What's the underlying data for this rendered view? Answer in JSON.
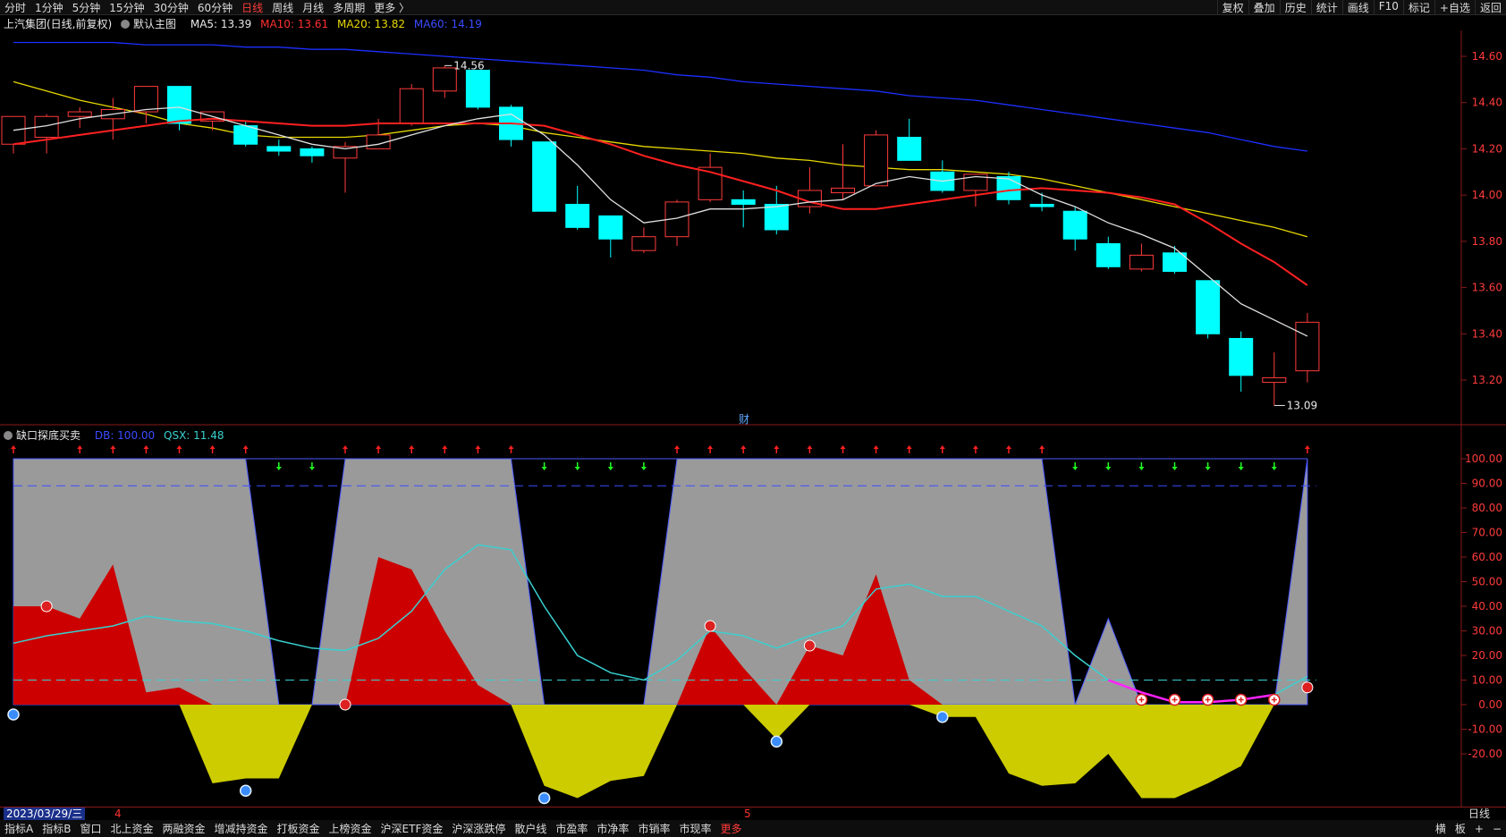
{
  "toolbar": {
    "periods": [
      "分时",
      "1分钟",
      "5分钟",
      "15分钟",
      "30分钟",
      "60分钟",
      "日线",
      "周线",
      "月线",
      "多周期",
      "更多 〉"
    ],
    "active_period": "日线",
    "right_buttons": [
      "复权",
      "叠加",
      "历史",
      "统计",
      "画线",
      "F10",
      "标记",
      "+自选",
      "返回"
    ]
  },
  "main_panel": {
    "title": "上汽集团(日线,前复权)",
    "template": "默认主图",
    "ma5": "MA5: 13.39",
    "ma10": "MA10: 13.61",
    "ma20": "MA20: 13.82",
    "ma60": "MA60: 14.19",
    "high_label": "14.56",
    "low_label": "13.09",
    "fin_marker": "财",
    "y_ticks": [
      "14.60",
      "14.40",
      "14.20",
      "14.00",
      "13.80",
      "13.60",
      "13.40",
      "13.20"
    ],
    "colors": {
      "ma5": "#e0e0e0",
      "ma10": "#ff2020",
      "ma20": "#e8d800",
      "ma60": "#1c2fff",
      "up": "#ff3b3b",
      "down": "#00ffff"
    }
  },
  "indicator_panel": {
    "name": "缺口探底买卖",
    "db": "DB: 100.00",
    "qsx": "QSX: 11.48",
    "y_ticks": [
      "100.00",
      "90.00",
      "80.00",
      "70.00",
      "60.00",
      "50.00",
      "40.00",
      "30.00",
      "20.00",
      "10.00",
      "0.00",
      "-10.00",
      "-20.00"
    ]
  },
  "date_bar": {
    "date": "2023/03/29/三",
    "month_marks": [
      "4",
      "5"
    ],
    "period_tag": "日线"
  },
  "bottom_tabs": [
    "指标A",
    "指标B",
    "窗口",
    "北上资金",
    "两融资金",
    "增减持资金",
    "打板资金",
    "上榜资金",
    "沪深ETF资金",
    "沪深涨跌停",
    "散户线",
    "市盈率",
    "市净率",
    "市销率",
    "市现率",
    "更多"
  ],
  "bottom_right": [
    "横",
    "板",
    "+",
    "−"
  ],
  "chart_data": [
    {
      "type": "candlestick",
      "title": "上汽集团(日线,前复权)",
      "ylim": [
        13.0,
        14.7
      ],
      "candles": [
        {
          "o": 14.22,
          "h": 14.28,
          "l": 14.18,
          "c": 14.34
        },
        {
          "o": 14.25,
          "h": 14.35,
          "l": 14.18,
          "c": 14.34
        },
        {
          "o": 14.34,
          "h": 14.38,
          "l": 14.29,
          "c": 14.36
        },
        {
          "o": 14.33,
          "h": 14.42,
          "l": 14.24,
          "c": 14.37
        },
        {
          "o": 14.36,
          "h": 14.47,
          "l": 14.31,
          "c": 14.47
        },
        {
          "o": 14.47,
          "h": 14.47,
          "l": 14.28,
          "c": 14.31
        },
        {
          "o": 14.32,
          "h": 14.36,
          "l": 14.28,
          "c": 14.36
        },
        {
          "o": 14.3,
          "h": 14.32,
          "l": 14.21,
          "c": 14.22
        },
        {
          "o": 14.21,
          "h": 14.24,
          "l": 14.17,
          "c": 14.19
        },
        {
          "o": 14.2,
          "h": 14.21,
          "l": 14.14,
          "c": 14.17
        },
        {
          "o": 14.16,
          "h": 14.23,
          "l": 14.01,
          "c": 14.21
        },
        {
          "o": 14.2,
          "h": 14.33,
          "l": 14.2,
          "c": 14.26
        },
        {
          "o": 14.31,
          "h": 14.48,
          "l": 14.3,
          "c": 14.46
        },
        {
          "o": 14.45,
          "h": 14.56,
          "l": 14.42,
          "c": 14.55
        },
        {
          "o": 14.54,
          "h": 14.54,
          "l": 14.37,
          "c": 14.38
        },
        {
          "o": 14.38,
          "h": 14.39,
          "l": 14.21,
          "c": 14.24
        },
        {
          "o": 14.23,
          "h": 14.23,
          "l": 13.93,
          "c": 13.93
        },
        {
          "o": 13.96,
          "h": 14.04,
          "l": 13.85,
          "c": 13.86
        },
        {
          "o": 13.91,
          "h": 13.91,
          "l": 13.73,
          "c": 13.81
        },
        {
          "o": 13.76,
          "h": 13.86,
          "l": 13.75,
          "c": 13.82
        },
        {
          "o": 13.82,
          "h": 13.98,
          "l": 13.78,
          "c": 13.97
        },
        {
          "o": 13.98,
          "h": 14.18,
          "l": 13.97,
          "c": 14.12
        },
        {
          "o": 13.98,
          "h": 14.02,
          "l": 13.86,
          "c": 13.96
        },
        {
          "o": 13.96,
          "h": 14.04,
          "l": 13.83,
          "c": 13.85
        },
        {
          "o": 13.95,
          "h": 14.12,
          "l": 13.92,
          "c": 14.02
        },
        {
          "o": 14.01,
          "h": 14.22,
          "l": 13.98,
          "c": 14.03
        },
        {
          "o": 14.04,
          "h": 14.28,
          "l": 14.04,
          "c": 14.26
        },
        {
          "o": 14.25,
          "h": 14.33,
          "l": 14.15,
          "c": 14.15
        },
        {
          "o": 14.1,
          "h": 14.15,
          "l": 14.01,
          "c": 14.02
        },
        {
          "o": 14.02,
          "h": 14.09,
          "l": 13.95,
          "c": 14.09
        },
        {
          "o": 14.08,
          "h": 14.1,
          "l": 13.96,
          "c": 13.98
        },
        {
          "o": 13.96,
          "h": 14.01,
          "l": 13.93,
          "c": 13.95
        },
        {
          "o": 13.93,
          "h": 13.95,
          "l": 13.76,
          "c": 13.81
        },
        {
          "o": 13.79,
          "h": 13.82,
          "l": 13.68,
          "c": 13.69
        },
        {
          "o": 13.68,
          "h": 13.79,
          "l": 13.67,
          "c": 13.74
        },
        {
          "o": 13.75,
          "h": 13.78,
          "l": 13.66,
          "c": 13.67
        },
        {
          "o": 13.63,
          "h": 13.63,
          "l": 13.38,
          "c": 13.4
        },
        {
          "o": 13.38,
          "h": 13.41,
          "l": 13.15,
          "c": 13.22
        },
        {
          "o": 13.19,
          "h": 13.32,
          "l": 13.09,
          "c": 13.21
        },
        {
          "o": 13.24,
          "h": 13.49,
          "l": 13.19,
          "c": 13.45
        }
      ],
      "ma5": [
        14.28,
        14.3,
        14.33,
        14.35,
        14.37,
        14.38,
        14.34,
        14.3,
        14.26,
        14.22,
        14.2,
        14.22,
        14.26,
        14.3,
        14.33,
        14.35,
        14.26,
        14.13,
        13.98,
        13.88,
        13.9,
        13.94,
        13.94,
        13.95,
        13.97,
        13.98,
        14.05,
        14.08,
        14.06,
        14.08,
        14.07,
        14.0,
        13.95,
        13.88,
        13.83,
        13.77,
        13.65,
        13.53,
        13.46,
        13.39
      ],
      "ma10": [
        14.22,
        14.24,
        14.26,
        14.28,
        14.3,
        14.32,
        14.33,
        14.32,
        14.31,
        14.3,
        14.3,
        14.31,
        14.31,
        14.31,
        14.31,
        14.31,
        14.3,
        14.26,
        14.22,
        14.17,
        14.13,
        14.1,
        14.06,
        14.02,
        13.97,
        13.94,
        13.94,
        13.96,
        13.98,
        14.0,
        14.02,
        14.03,
        14.02,
        14.01,
        13.99,
        13.96,
        13.88,
        13.79,
        13.71,
        13.61
      ],
      "ma20": [
        14.49,
        14.45,
        14.41,
        14.38,
        14.35,
        14.31,
        14.29,
        14.26,
        14.25,
        14.25,
        14.25,
        14.26,
        14.28,
        14.3,
        14.31,
        14.3,
        14.27,
        14.25,
        14.23,
        14.21,
        14.2,
        14.19,
        14.18,
        14.16,
        14.15,
        14.13,
        14.12,
        14.11,
        14.11,
        14.1,
        14.09,
        14.07,
        14.04,
        14.01,
        13.98,
        13.95,
        13.92,
        13.89,
        13.86,
        13.82
      ],
      "ma60": [
        14.66,
        14.66,
        14.66,
        14.66,
        14.65,
        14.65,
        14.65,
        14.64,
        14.64,
        14.63,
        14.63,
        14.62,
        14.61,
        14.6,
        14.59,
        14.58,
        14.57,
        14.56,
        14.55,
        14.54,
        14.52,
        14.51,
        14.49,
        14.48,
        14.47,
        14.46,
        14.45,
        14.43,
        14.42,
        14.41,
        14.39,
        14.37,
        14.35,
        14.33,
        14.31,
        14.29,
        14.27,
        14.24,
        14.21,
        14.19
      ]
    },
    {
      "type": "area",
      "title": "缺口探底买卖",
      "ylim": [
        -30,
        105
      ],
      "grey": [
        100,
        100,
        100,
        100,
        100,
        100,
        100,
        100,
        0,
        0,
        100,
        100,
        100,
        100,
        100,
        100,
        0,
        0,
        0,
        0,
        100,
        100,
        100,
        100,
        100,
        100,
        100,
        100,
        100,
        100,
        100,
        100,
        0,
        35,
        0,
        0,
        0,
        0,
        0,
        100
      ],
      "red": [
        40,
        40,
        35,
        57,
        5,
        7,
        0,
        0,
        0,
        0,
        0,
        60,
        55,
        30,
        8,
        0,
        0,
        0,
        0,
        0,
        0,
        32,
        15,
        0,
        24,
        20,
        53,
        10,
        0,
        0,
        0,
        0,
        0,
        0,
        0,
        0,
        0,
        0,
        0,
        0
      ],
      "yellow": [
        0,
        0,
        0,
        0,
        0,
        0,
        -32,
        -30,
        -30,
        0,
        0,
        0,
        0,
        0,
        0,
        0,
        -33,
        -38,
        -31,
        -29,
        0,
        0,
        0,
        -14,
        0,
        0,
        0,
        0,
        -5,
        -5,
        -28,
        -33,
        -32,
        -20,
        -38,
        -38,
        -32,
        -25,
        0,
        0
      ],
      "qsx": [
        25,
        28,
        30,
        32,
        36,
        34,
        33,
        30,
        26,
        23,
        22,
        27,
        38,
        55,
        65,
        63,
        40,
        20,
        13,
        10,
        18,
        30,
        28,
        23,
        28,
        32,
        47,
        49,
        44,
        44,
        38,
        32,
        20,
        10,
        5,
        1,
        1,
        2,
        4,
        11.48
      ],
      "db": 100,
      "dashed_blue": 89,
      "dashed_cyan": 10,
      "up_arrows": [
        0,
        2,
        3,
        4,
        5,
        6,
        7,
        10,
        11,
        12,
        13,
        14,
        15,
        20,
        21,
        22,
        23,
        24,
        25,
        26,
        27,
        28,
        29,
        30,
        31,
        39
      ],
      "down_arrows": [
        8,
        9,
        16,
        17,
        18,
        19,
        32,
        33,
        34,
        35,
        36,
        37,
        38
      ],
      "red_balls": [
        [
          1,
          40
        ],
        [
          10,
          0
        ],
        [
          21,
          32
        ],
        [
          24,
          24
        ],
        [
          39,
          7
        ]
      ],
      "blue_balls": [
        [
          0,
          -4
        ],
        [
          7,
          -35
        ],
        [
          16,
          -38
        ],
        [
          23,
          -15
        ],
        [
          28,
          -5
        ]
      ],
      "plus_markers": [
        [
          34,
          2
        ],
        [
          35,
          2
        ],
        [
          36,
          2
        ],
        [
          37,
          2
        ],
        [
          38,
          2
        ]
      ]
    }
  ]
}
